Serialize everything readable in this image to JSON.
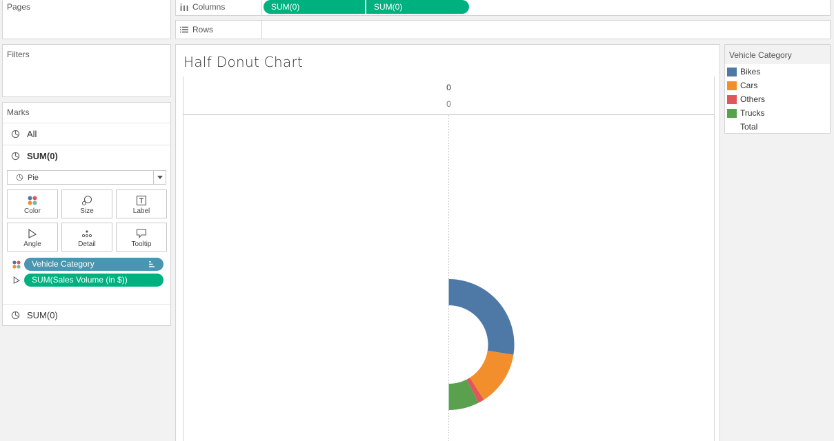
{
  "left": {
    "pages_title": "Pages",
    "filters_title": "Filters",
    "marks": {
      "title": "Marks",
      "all_label": "All",
      "layer1_label": "SUM(0)",
      "mark_type": "Pie",
      "cards": {
        "color": "Color",
        "size": "Size",
        "label": "Label",
        "angle": "Angle",
        "detail": "Detail",
        "tooltip": "Tooltip"
      },
      "fields": [
        {
          "label": "Vehicle Category",
          "color": "#4996b2"
        },
        {
          "label": "SUM(Sales Volume (in $))",
          "color": "#00b180"
        }
      ],
      "layer2_label": "SUM(0)"
    }
  },
  "shelves": {
    "columns_label": "Columns",
    "column_pills": [
      "SUM(0)",
      "SUM(0)"
    ],
    "rows_label": "Rows"
  },
  "view": {
    "title": "Half Donut Chart",
    "header_top": "0",
    "header_sub": "0"
  },
  "legend": {
    "title": "Vehicle Category",
    "items": [
      {
        "label": "Bikes",
        "color": "#4e79a7"
      },
      {
        "label": "Cars",
        "color": "#f28e2b"
      },
      {
        "label": "Others",
        "color": "#e15759"
      },
      {
        "label": "Trucks",
        "color": "#59a14f"
      },
      {
        "label": "Total",
        "color": null
      }
    ]
  },
  "chart_data": {
    "type": "pie",
    "title": "Half Donut Chart",
    "categories": [
      "Bikes",
      "Cars",
      "Others",
      "Trucks",
      "Total"
    ],
    "shares_of_full_circle": [
      0.275,
      0.135,
      0.015,
      0.075,
      0.5
    ],
    "colors": [
      "#4e79a7",
      "#f28e2b",
      "#e15759",
      "#59a14f",
      "#ffffff"
    ]
  }
}
